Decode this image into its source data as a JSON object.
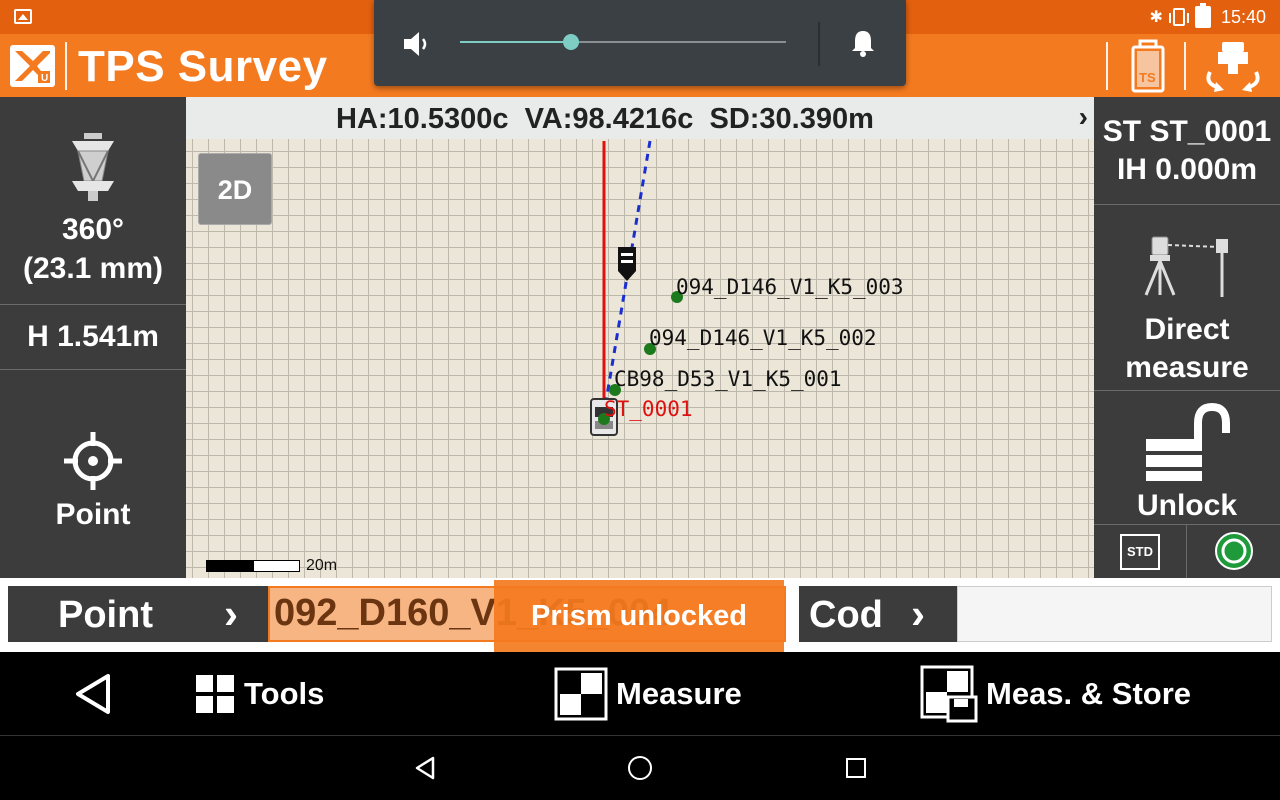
{
  "status_bar": {
    "time": "15:40",
    "icons": [
      "image-icon",
      "bluetooth-icon",
      "vibrate-icon",
      "battery-icon"
    ]
  },
  "app_bar": {
    "title": "TPS Survey",
    "ts_battery_label": "TS",
    "brand_color": "#f47a20"
  },
  "volume_overlay": {
    "level_percent": 34,
    "icons": [
      "speaker-icon",
      "bell-icon"
    ],
    "accent": "#7ecdc4"
  },
  "left_panel": {
    "prism_line1": "360°",
    "prism_line2": "(23.1 mm)",
    "height": "H 1.541m",
    "point_label": "Point"
  },
  "map": {
    "header": "HA:10.5300c  VA:98.4216c  SD:30.390m",
    "header_chevron": "›",
    "mode_button": "2D",
    "scale_label": "20m",
    "station_label": "ST_0001",
    "points": [
      {
        "name": "094_D146_V1_K5_003"
      },
      {
        "name": "094_D146_V1_K5_002"
      },
      {
        "name": "CB98_D53_V1_K5_001"
      }
    ]
  },
  "right_panel": {
    "station": "ST ST_0001",
    "instrument_height": "IH 0.000m",
    "direct_line1": "Direct",
    "direct_line2": "measure",
    "unlock": "Unlock",
    "std": "STD"
  },
  "point_bar": {
    "point_button": "Point",
    "point_arrow": "›",
    "point_name": "092_D160_V1_K5_004",
    "toast": "Prism unlocked",
    "code_button": "Cod",
    "code_arrow": "›",
    "code_value": ""
  },
  "bottom_bar": {
    "tools": "Tools",
    "measure": "Measure",
    "meas_store": "Meas. & Store"
  }
}
